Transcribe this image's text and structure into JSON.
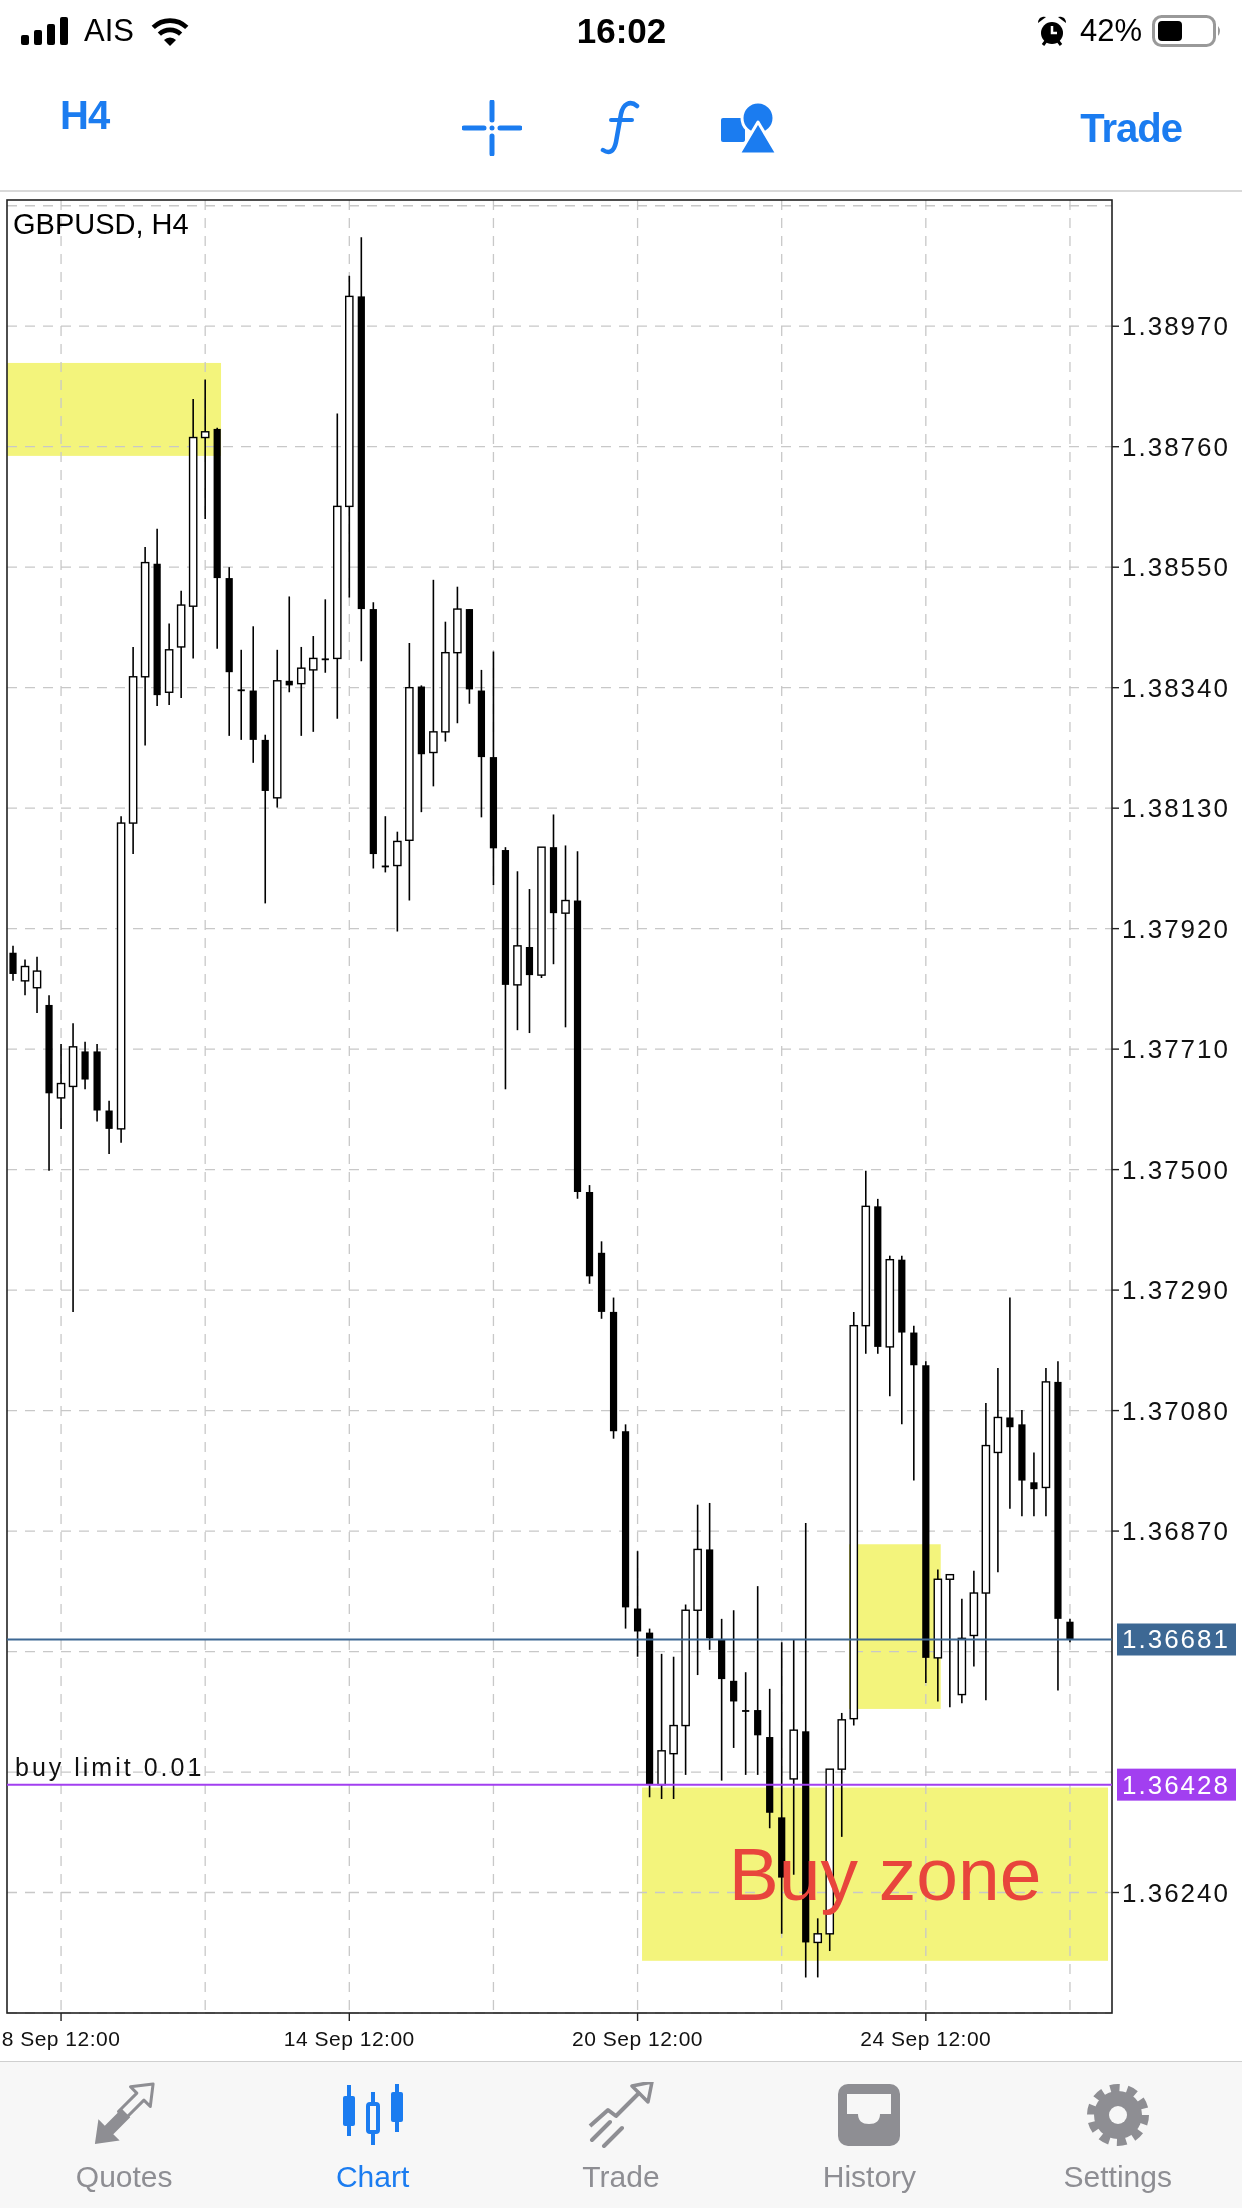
{
  "status_bar": {
    "carrier": "AIS",
    "time": "16:02",
    "battery": "42%"
  },
  "toolbar": {
    "timeframe": "H4",
    "trade": "Trade"
  },
  "chart": {
    "chart_data": {
      "type": "candlestick",
      "title": "GBPUSD, H4",
      "categories": [
        null,
        null,
        null,
        null,
        "8 Sep 12:00",
        null,
        null,
        null,
        null,
        null,
        null,
        null,
        null,
        null,
        null,
        null,
        null,
        null,
        null,
        null,
        null,
        null,
        null,
        null,
        null,
        null,
        null,
        null,
        "14 Sep 12:00",
        null,
        null,
        null,
        null,
        null,
        null,
        null,
        null,
        null,
        null,
        null,
        null,
        null,
        null,
        null,
        null,
        null,
        null,
        null,
        null,
        null,
        null,
        null,
        "20 Sep 12:00",
        null,
        null,
        null,
        null,
        null,
        null,
        null,
        null,
        null,
        null,
        null,
        null,
        null,
        null,
        null,
        null,
        null,
        null,
        null,
        null,
        null,
        null,
        null,
        "24 Sep 12:00",
        null,
        null,
        null,
        null,
        null,
        null,
        null,
        null,
        null,
        null,
        null,
        null,
        null,
        null,
        null
      ],
      "ohlc": [
        [
          1.37878,
          1.3789,
          1.37829,
          1.37841
        ],
        [
          1.37829,
          1.37866,
          1.37804,
          1.37854
        ],
        [
          1.37817,
          1.37871,
          1.37773,
          1.37846
        ],
        [
          1.37787,
          1.37804,
          1.37498,
          1.37633
        ],
        [
          1.37625,
          1.37719,
          1.37571,
          1.3765
        ],
        [
          1.37645,
          1.37755,
          1.37252,
          1.37714
        ],
        [
          1.37706,
          1.37723,
          1.3764,
          1.37657
        ],
        [
          1.37706,
          1.37719,
          1.37584,
          1.37603
        ],
        [
          1.37603,
          1.3762,
          1.37527,
          1.37571
        ],
        [
          1.37571,
          1.38116,
          1.37547,
          1.38104
        ],
        [
          1.38104,
          1.38411,
          1.3805,
          1.38359
        ],
        [
          1.38359,
          1.38585,
          1.38239,
          1.38558
        ],
        [
          1.38556,
          1.38617,
          1.38308,
          1.38327
        ],
        [
          1.38332,
          1.38452,
          1.3831,
          1.38406
        ],
        [
          1.38411,
          1.38509,
          1.38322,
          1.38484
        ],
        [
          1.38482,
          1.38843,
          1.38391,
          1.38776
        ],
        [
          1.38776,
          1.38877,
          1.38634,
          1.38786
        ],
        [
          1.38791,
          1.38793,
          1.38408,
          1.38531
        ],
        [
          1.38531,
          1.3855,
          1.38256,
          1.38367
        ],
        [
          1.38337,
          1.38406,
          1.38249,
          1.38335
        ],
        [
          1.38335,
          1.38447,
          1.38209,
          1.38249
        ],
        [
          1.38249,
          1.38258,
          1.37964,
          1.3816
        ],
        [
          1.38148,
          1.38406,
          1.38131,
          1.38352
        ],
        [
          1.38352,
          1.38499,
          1.38332,
          1.38344
        ],
        [
          1.38347,
          1.38411,
          1.38256,
          1.38374
        ],
        [
          1.38371,
          1.3843,
          1.38263,
          1.38391
        ],
        [
          1.38391,
          1.38494,
          1.38366,
          1.38389
        ],
        [
          1.38391,
          1.38818,
          1.38286,
          1.38656
        ],
        [
          1.38656,
          1.39058,
          1.38497,
          1.39022
        ],
        [
          1.39022,
          1.39125,
          1.38386,
          1.38477
        ],
        [
          1.38477,
          1.38489,
          1.38025,
          1.3805
        ],
        [
          1.3803,
          1.38116,
          1.38018,
          1.38028
        ],
        [
          1.3803,
          1.38089,
          1.37915,
          1.38072
        ],
        [
          1.38074,
          1.38418,
          1.37969,
          1.3834
        ],
        [
          1.38342,
          1.38344,
          1.38123,
          1.38224
        ],
        [
          1.38227,
          1.38528,
          1.38168,
          1.38263
        ],
        [
          1.38263,
          1.38455,
          1.38246,
          1.38401
        ],
        [
          1.38401,
          1.38516,
          1.38278,
          1.38477
        ],
        [
          1.38477,
          1.38477,
          1.38312,
          1.38337
        ],
        [
          1.38335,
          1.38371,
          1.38114,
          1.38219
        ],
        [
          1.38219,
          1.38403,
          1.37996,
          1.3806
        ],
        [
          1.38057,
          1.38062,
          1.3764,
          1.37822
        ],
        [
          1.37822,
          1.3802,
          1.37743,
          1.3789
        ],
        [
          1.37888,
          1.37989,
          1.37738,
          1.37839
        ],
        [
          1.37839,
          1.38062,
          1.37834,
          1.38062
        ],
        [
          1.38062,
          1.38119,
          1.37858,
          1.37947
        ],
        [
          1.37947,
          1.38065,
          1.37748,
          1.37969
        ],
        [
          1.37969,
          1.38055,
          1.37449,
          1.37461
        ],
        [
          1.37461,
          1.37473,
          1.37301,
          1.37314
        ],
        [
          1.37355,
          1.37375,
          1.3724,
          1.37252
        ],
        [
          1.37252,
          1.37277,
          1.37031,
          1.37044
        ],
        [
          1.37044,
          1.37056,
          1.367,
          1.36737
        ],
        [
          1.36735,
          1.36835,
          1.36651,
          1.36695
        ],
        [
          1.36693,
          1.367,
          1.36406,
          1.36428
        ],
        [
          1.36428,
          1.36656,
          1.36403,
          1.36487
        ],
        [
          1.36482,
          1.36651,
          1.36403,
          1.36531
        ],
        [
          1.36531,
          1.36742,
          1.36445,
          1.36732
        ],
        [
          1.36732,
          1.36916,
          1.36619,
          1.36838
        ],
        [
          1.36838,
          1.36919,
          1.36663,
          1.36683
        ],
        [
          1.36681,
          1.36717,
          1.36435,
          1.36612
        ],
        [
          1.36609,
          1.36732,
          1.36492,
          1.36573
        ],
        [
          1.36558,
          1.36624,
          1.36445,
          1.36555
        ],
        [
          1.36558,
          1.36774,
          1.36445,
          1.36514
        ],
        [
          1.36511,
          1.36595,
          1.36352,
          1.36379
        ],
        [
          1.36371,
          1.36676,
          1.36168,
          1.36266
        ],
        [
          1.36438,
          1.36681,
          1.36271,
          1.36523
        ],
        [
          1.36521,
          1.36884,
          1.36092,
          1.36153
        ],
        [
          1.36153,
          1.36195,
          1.36092,
          1.36168
        ],
        [
          1.36168,
          1.36455,
          1.36138,
          1.36455
        ],
        [
          1.36455,
          1.36553,
          1.36337,
          1.36541
        ],
        [
          1.36543,
          1.37252,
          1.36531,
          1.37228
        ],
        [
          1.37228,
          1.37498,
          1.37179,
          1.37436
        ],
        [
          1.37436,
          1.37449,
          1.37179,
          1.37191
        ],
        [
          1.37191,
          1.3735,
          1.37105,
          1.37343
        ],
        [
          1.37343,
          1.3735,
          1.37056,
          1.37216
        ],
        [
          1.37216,
          1.37228,
          1.36958,
          1.37159
        ],
        [
          1.37159,
          1.37166,
          1.36605,
          1.36649
        ],
        [
          1.36649,
          1.36803,
          1.36573,
          1.36786
        ],
        [
          1.36786,
          1.36794,
          1.36563,
          1.36794
        ],
        [
          1.36585,
          1.36752,
          1.3657,
          1.36683
        ],
        [
          1.36688,
          1.36801,
          1.36634,
          1.36762
        ],
        [
          1.36762,
          1.37093,
          1.36575,
          1.37019
        ],
        [
          1.37007,
          1.37154,
          1.36798,
          1.37068
        ],
        [
          1.37068,
          1.37277,
          1.36909,
          1.37051
        ],
        [
          1.37056,
          1.37081,
          1.36896,
          1.36958
        ],
        [
          1.36955,
          1.37007,
          1.36896,
          1.36943
        ],
        [
          1.36946,
          1.37154,
          1.36896,
          1.3713
        ],
        [
          1.3713,
          1.37166,
          1.36592,
          1.36717
        ],
        [
          1.36712,
          1.36717,
          1.36676,
          1.36681
        ],
        null,
        null,
        null
      ],
      "ylim": [
        1.3603,
        1.3919
      ],
      "yticks": [
        {
          "value": 1.3897,
          "label": "1.38970"
        },
        {
          "value": 1.3876,
          "label": "1.38760"
        },
        {
          "value": 1.3855,
          "label": "1.38550"
        },
        {
          "value": 1.3834,
          "label": "1.38340"
        },
        {
          "value": 1.3813,
          "label": "1.38130"
        },
        {
          "value": 1.3792,
          "label": "1.37920"
        },
        {
          "value": 1.3771,
          "label": "1.37710"
        },
        {
          "value": 1.375,
          "label": "1.37500"
        },
        {
          "value": 1.3729,
          "label": "1.37290"
        },
        {
          "value": 1.3708,
          "label": "1.37080"
        },
        {
          "value": 1.3687,
          "label": "1.36870"
        },
        {
          "value": 1.3624,
          "label": "1.36240"
        }
      ],
      "grid": true,
      "ref_lines": [
        {
          "axis": "y",
          "value": 1.36681,
          "label": "1.36681",
          "color": "#3d6894"
        },
        {
          "axis": "y",
          "value": 1.36428,
          "label": "1.36428",
          "color": "#a23ff0"
        }
      ],
      "bands": [
        {
          "axis": "y",
          "from": 1.38744,
          "to": 1.38906
        },
        {
          "axis": "y",
          "from": 1.3656,
          "to": 1.36847
        },
        {
          "axis": "y",
          "from": 1.36121,
          "to": 1.36423
        }
      ],
      "annotations": [
        "buy limit 0.01",
        "Buy zone"
      ]
    }
  },
  "tab_bar": [
    {
      "label": "Quotes",
      "selected": false
    },
    {
      "label": "Chart",
      "selected": true
    },
    {
      "label": "Trade",
      "selected": false
    },
    {
      "label": "History",
      "selected": false
    },
    {
      "label": "Settings",
      "selected": false
    }
  ]
}
